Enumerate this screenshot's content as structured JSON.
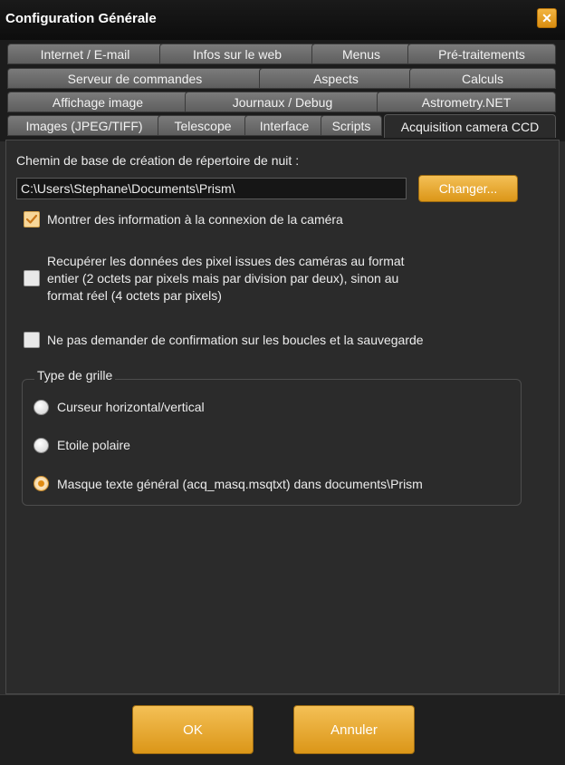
{
  "window": {
    "title": "Configuration Générale",
    "close_symbol": "✕"
  },
  "tabs": {
    "row1": [
      "Internet / E-mail",
      "Infos sur le web",
      "Menus",
      "Pré-traitements"
    ],
    "row2": [
      "Serveur de commandes",
      "Aspects",
      "Calculs"
    ],
    "row3": [
      "Affichage image",
      "Journaux / Debug",
      "Astrometry.NET"
    ],
    "row4": [
      "Images (JPEG/TIFF)",
      "Telescope",
      "Interface",
      "Scripts",
      "Acquisition camera CCD"
    ],
    "active": "Acquisition camera CCD"
  },
  "acquisition": {
    "path_label": "Chemin de  base de création de répertoire de nuit :",
    "path_value": "C:\\Users\\Stephane\\Documents\\Prism\\",
    "change_button": "Changer...",
    "checkboxes": [
      {
        "label": "Montrer des information à la connexion de la caméra",
        "checked": true
      },
      {
        "label_lines": [
          "Recupérer les données des pixel issues des caméras au format",
          "entier (2 octets par pixels mais par division par deux), sinon au",
          "format réel (4 octets par pixels)"
        ],
        "checked": false
      },
      {
        "label": "Ne pas demander de confirmation sur les boucles et la sauvegarde",
        "checked": false
      }
    ]
  },
  "grid_type": {
    "title": "Type de grille",
    "options": [
      {
        "label": "Curseur horizontal/vertical",
        "selected": false
      },
      {
        "label": "Etoile polaire",
        "selected": false
      },
      {
        "label": "Masque texte général (acq_masq.msqtxt) dans documents\\Prism",
        "selected": true
      }
    ]
  },
  "footer": {
    "ok": "OK",
    "cancel": "Annuler"
  },
  "colors": {
    "accent": "#e8a22a",
    "panel_bg": "#2b2b2b",
    "tab_bg": "#6b6b6b"
  },
  "icons": {
    "close": "close-icon",
    "checkmark": "check-icon"
  }
}
